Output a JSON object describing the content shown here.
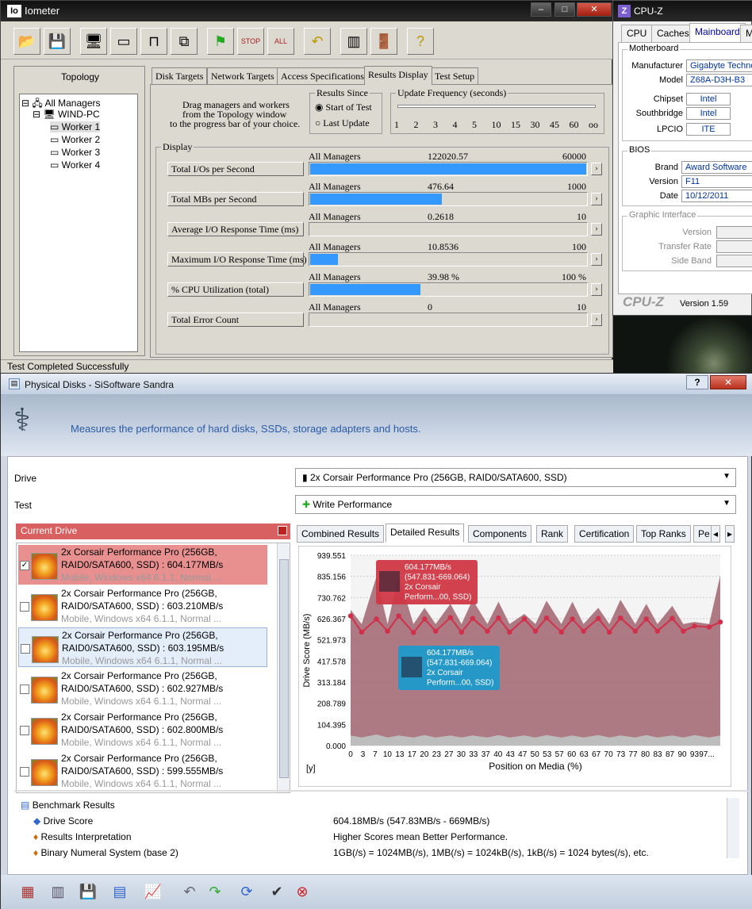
{
  "iometer": {
    "title": "Iometer",
    "logo": "Io",
    "topology_header": "Topology",
    "tree": [
      "All Managers",
      "WIND-PC",
      "Worker 1",
      "Worker 2",
      "Worker 3",
      "Worker 4"
    ],
    "tabs": [
      "Disk Targets",
      "Network Targets",
      "Access Specifications",
      "Results Display",
      "Test Setup"
    ],
    "drag_text": [
      "Drag managers and workers",
      "from the Topology window",
      "to the progress bar of your choice."
    ],
    "results_since": {
      "label": "Results Since",
      "opt1": "Start of Test",
      "opt2": "Last Update"
    },
    "update_freq": {
      "label": "Update Frequency (seconds)",
      "ticks": [
        "1",
        "2",
        "3",
        "4",
        "5",
        "10",
        "15",
        "30",
        "45",
        "60",
        "oo"
      ]
    },
    "display_label": "Display",
    "rows": [
      {
        "name": "Total I/Os per Second",
        "mgr": "All Managers",
        "value": "122020.57",
        "max": "60000",
        "fill": 1.0
      },
      {
        "name": "Total MBs per Second",
        "mgr": "All Managers",
        "value": "476.64",
        "max": "1000",
        "fill": 0.477
      },
      {
        "name": "Average I/O Response Time (ms)",
        "mgr": "All Managers",
        "value": "0.2618",
        "max": "10",
        "fill": 0.0
      },
      {
        "name": "Maximum I/O Response Time (ms)",
        "mgr": "All Managers",
        "value": "10.8536",
        "max": "100",
        "fill": 0.1
      },
      {
        "name": "% CPU Utilization (total)",
        "mgr": "All Managers",
        "value": "39.98 %",
        "max": "100 %",
        "fill": 0.4
      },
      {
        "name": "Total Error Count",
        "mgr": "All Managers",
        "value": "0",
        "max": "10",
        "fill": 0.0
      }
    ],
    "status": "Test Completed Successfully"
  },
  "cpuz": {
    "title": "CPU-Z",
    "tabs": [
      "CPU",
      "Caches",
      "Mainboard",
      "Me"
    ],
    "motherboard_label": "Motherboard",
    "manufacturer_label": "Manufacturer",
    "manufacturer": "Gigabyte Techno",
    "model_label": "Model",
    "model": "Z68A-D3H-B3",
    "chipset_label": "Chipset",
    "chipset": "Intel",
    "southbridge_label": "Southbridge",
    "southbridge": "Intel",
    "lpcio_label": "LPCIO",
    "lpcio": "ITE",
    "bios_label": "BIOS",
    "brand_label": "Brand",
    "brand": "Award Software",
    "version_label": "Version",
    "version": "F11",
    "date_label": "Date",
    "date": "10/12/2011",
    "graphic_label": "Graphic Interface",
    "gi_version": "Version",
    "gi_transfer": "Transfer Rate",
    "gi_side": "Side Band",
    "footer_logo": "CPU-Z",
    "footer_version": "Version 1.59"
  },
  "sandra": {
    "title": "Physical Disks - SiSoftware Sandra",
    "header_text": "Measures the performance of hard disks, SSDs, storage adapters and hosts.",
    "drive_label": "Drive",
    "drive_value": "2x  Corsair Performance Pro (256GB, RAID0/SATA600, SSD)",
    "test_label": "Test",
    "test_value": "Write Performance",
    "current_drive": "Current Drive",
    "drives": [
      {
        "l1": "2x  Corsair Performance Pro (256GB,",
        "l2": "RAID0/SATA600, SSD) : 604.177MB/s",
        "l3": "Mobile, Windows x64 6.1.1, Normal ..."
      },
      {
        "l1": "2x  Corsair Performance Pro (256GB,",
        "l2": "RAID0/SATA600, SSD) : 603.210MB/s",
        "l3": "Mobile, Windows x64 6.1.1, Normal ..."
      },
      {
        "l1": "2x  Corsair Performance Pro (256GB,",
        "l2": "RAID0/SATA600, SSD) : 603.195MB/s",
        "l3": "Mobile, Windows x64 6.1.1, Normal ..."
      },
      {
        "l1": "2x  Corsair Performance Pro (256GB,",
        "l2": "RAID0/SATA600, SSD) : 602.927MB/s",
        "l3": "Mobile, Windows x64 6.1.1, Normal ..."
      },
      {
        "l1": "2x  Corsair Performance Pro (256GB,",
        "l2": "RAID0/SATA600, SSD) : 602.800MB/s",
        "l3": "Mobile, Windows x64 6.1.1, Normal ..."
      },
      {
        "l1": "2x  Corsair Performance Pro (256GB,",
        "l2": "RAID0/SATA600, SSD) : 599.555MB/s",
        "l3": "Mobile, Windows x64 6.1.1, Normal ..."
      }
    ],
    "tabs": [
      "Combined Results",
      "Detailed Results",
      "Components",
      "Rank",
      "Certification",
      "Top Ranks",
      "Pe"
    ],
    "tooltip1": [
      "604.177MB/s",
      "(547.831-669.064)",
      "2x  Corsair",
      "Perform...00, SSD)"
    ],
    "tooltip2": [
      "604.177MB/s",
      "(547.831-669.064)",
      "2x  Corsair",
      "Perform...00, SSD)"
    ],
    "corner_label": "[y]",
    "results_header": "Benchmark Results",
    "results": [
      {
        "name": "Drive Score",
        "value": "604.18MB/s (547.83MB/s - 669MB/s)"
      },
      {
        "name": "Results Interpretation",
        "value": "Higher Scores mean Better Performance."
      },
      {
        "name": "Binary Numeral System (base 2)",
        "value": "1GB(/s) = 1024MB(/s), 1MB(/s) = 1024kB(/s), 1kB(/s) = 1024 bytes(/s), etc."
      }
    ]
  },
  "chart_data": {
    "type": "area",
    "xlabel": "Position on Media (%)",
    "ylabel": "Drive Score (MB/s)",
    "y_ticks": [
      "939.551",
      "835.156",
      "730.762",
      "626.367",
      "521.973",
      "417.578",
      "313.184",
      "208.789",
      "104.395",
      "0.000"
    ],
    "x_ticks": [
      "0",
      "3",
      "7",
      "10",
      "13",
      "17",
      "20",
      "23",
      "27",
      "30",
      "33",
      "37",
      "40",
      "43",
      "47",
      "50",
      "53",
      "57",
      "60",
      "63",
      "67",
      "70",
      "73",
      "77",
      "80",
      "83",
      "87",
      "90",
      "93",
      "97..."
    ],
    "ylim": [
      0,
      939.551
    ],
    "x": [
      0,
      3,
      7,
      10,
      13,
      17,
      20,
      23,
      27,
      30,
      33,
      37,
      40,
      43,
      47,
      50,
      53,
      57,
      60,
      63,
      67,
      70,
      73,
      77,
      80,
      83,
      87,
      90,
      93,
      97,
      100
    ],
    "series": [
      {
        "values": [
          640,
          560,
          625,
          565,
          640,
          558,
          625,
          565,
          632,
          560,
          628,
          565,
          630,
          560,
          625,
          565,
          630,
          560,
          625,
          565,
          628,
          560,
          630,
          565,
          625,
          565,
          628,
          565,
          590,
          585,
          610
        ]
      },
      {
        "values": [
          670,
          600,
          835,
          600,
          840,
          600,
          680,
          600,
          700,
          600,
          720,
          600,
          710,
          600,
          650,
          600,
          715,
          600,
          710,
          600,
          680,
          600,
          720,
          600,
          700,
          600,
          690,
          600,
          610,
          600,
          840
        ]
      },
      {
        "values": [
          50,
          40,
          55,
          40,
          50,
          40,
          52,
          40,
          50,
          40,
          50,
          40,
          52,
          40,
          50,
          40,
          52,
          40,
          50,
          40,
          52,
          40,
          50,
          40,
          52,
          40,
          50,
          40,
          52,
          40,
          50
        ]
      }
    ]
  }
}
